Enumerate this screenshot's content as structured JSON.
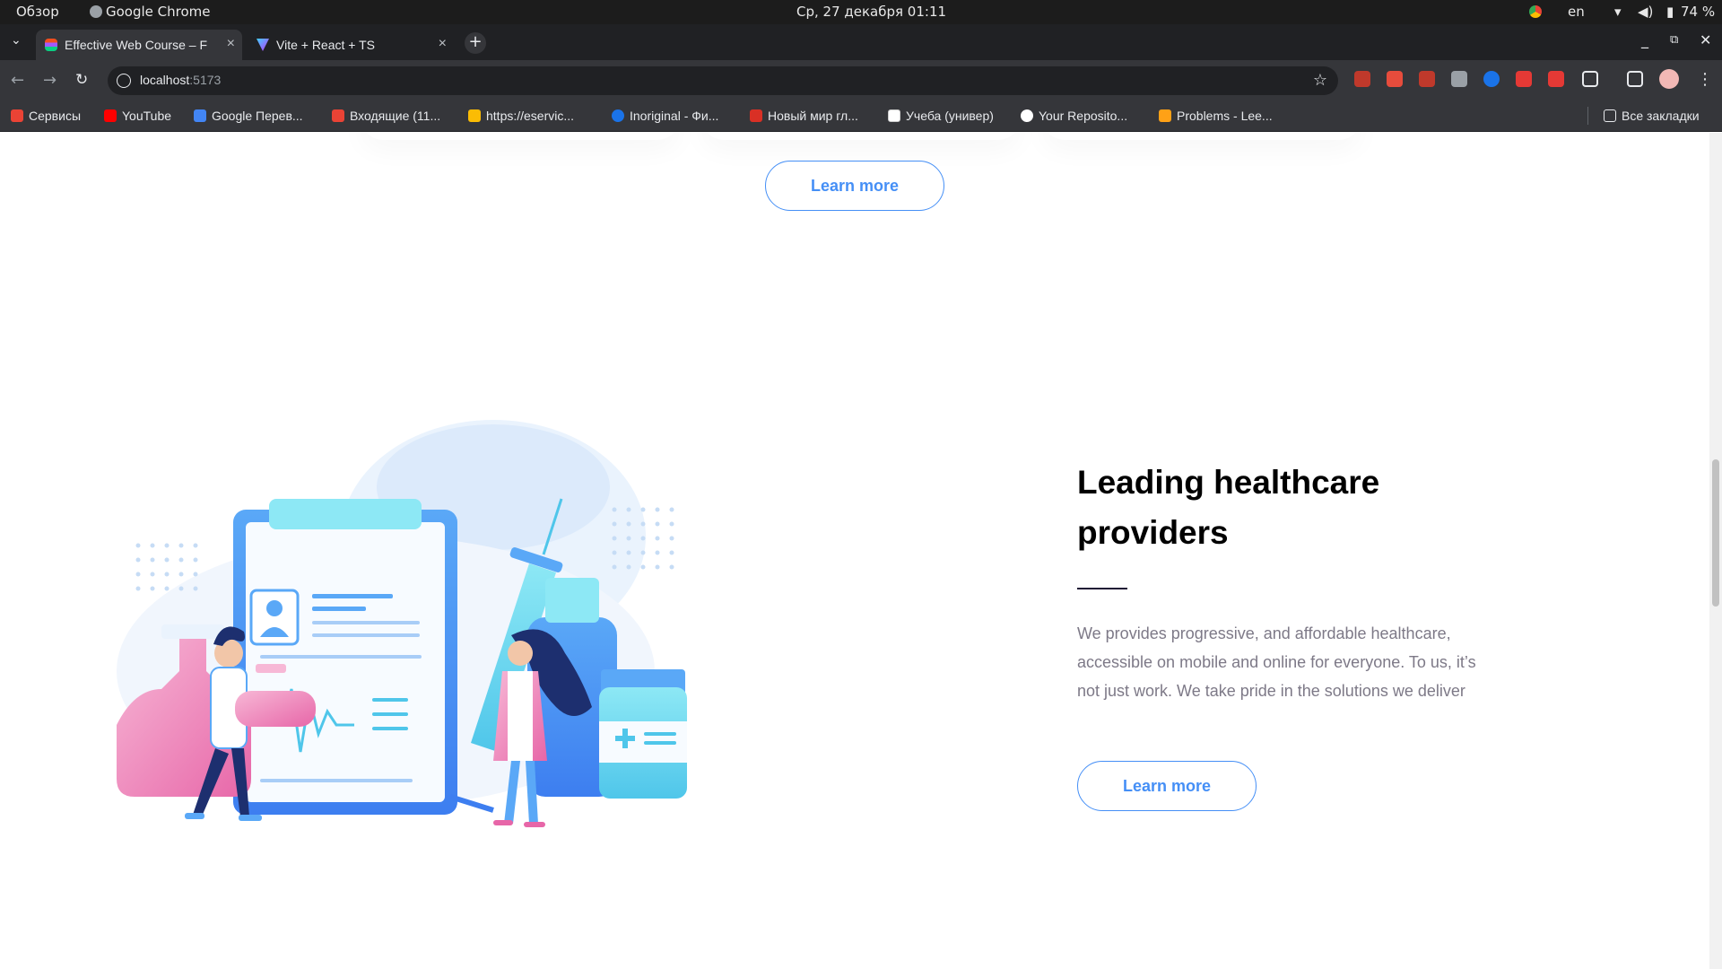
{
  "system_bar": {
    "overview": "Обзор",
    "app_name": "Google Chrome",
    "datetime": "Ср, 27 декабря  01:11",
    "lang": "en",
    "battery": "74 %"
  },
  "tabs": [
    {
      "label": "Effective Web Course – F",
      "active": true
    },
    {
      "label": "Vite + React + TS",
      "active": false
    }
  ],
  "address_bar": {
    "host": "localhost",
    "port": ":5173"
  },
  "bookmarks": [
    {
      "label": "Сервисы",
      "icon": "apps-grid-icon",
      "color": "#ea4335"
    },
    {
      "label": "YouTube",
      "icon": "youtube-icon",
      "color": "#ff0000"
    },
    {
      "label": "Google Перев...",
      "icon": "translate-icon",
      "color": "#4285f4"
    },
    {
      "label": "Входящие (11...",
      "icon": "gmail-icon",
      "color": "#ea4335"
    },
    {
      "label": "https://eservic...",
      "icon": "page-icon",
      "color": "#fbbc04"
    },
    {
      "label": "Inoriginal - Фи...",
      "icon": "play-icon",
      "color": "#1a73e8"
    },
    {
      "label": "Новый мир гл...",
      "icon": "book-icon",
      "color": "#d93025"
    },
    {
      "label": "Учеба (универ)",
      "icon": "notion-icon",
      "color": "#ffffff"
    },
    {
      "label": "Your Reposito...",
      "icon": "github-icon",
      "color": "#ffffff"
    },
    {
      "label": "Problems - Lee...",
      "icon": "leetcode-icon",
      "color": "#ffa116"
    }
  ],
  "all_bookmarks": "Все закладки",
  "page": {
    "top_button": "Learn more",
    "section": {
      "title_line1": "Leading healthcare",
      "title_line2": "providers",
      "description": "We provides progressive, and affordable healthcare, accessible on mobile and online for everyone. To us, it’s not just work. We take pride in the solutions we deliver",
      "button": "Learn more"
    }
  },
  "colors": {
    "accent": "#458ff6",
    "heading": "#000000",
    "body_text": "#7d7987"
  }
}
